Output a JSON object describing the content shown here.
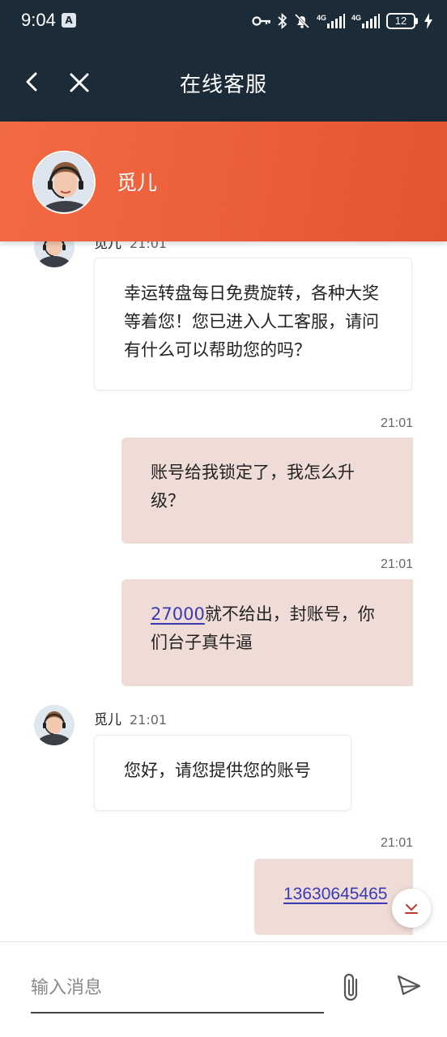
{
  "status_bar": {
    "time": "9:04",
    "app_icon_letter": "A",
    "battery_level": "12",
    "network_label_1": "4G",
    "network_label_2": "4G"
  },
  "app_bar": {
    "title": "在线客服",
    "back_icon": "chevron-left-icon",
    "close_icon": "close-icon"
  },
  "agent": {
    "name": "觅儿",
    "avatar_icon": "agent-avatar-headset"
  },
  "messages": [
    {
      "direction": "incoming",
      "sender": "觅儿",
      "time": "21:01",
      "text": "幸运转盘每日免费旋转，各种大奖等着您！您已进入人工客服，请问有什么可以帮助您的吗？"
    },
    {
      "direction": "outgoing",
      "time": "21:01",
      "text": "账号给我锁定了，我怎么升级？"
    },
    {
      "direction": "outgoing",
      "time": "21:01",
      "link_text": "27000",
      "text": "就不给出，封账号，你们台子真牛逼"
    },
    {
      "direction": "incoming",
      "sender": "觅儿",
      "time": "21:01",
      "text": "您好，请您提供您的账号"
    },
    {
      "direction": "outgoing",
      "time": "21:01",
      "link_text": "13630645465"
    }
  ],
  "input": {
    "placeholder": "输入消息",
    "value": ""
  },
  "colors": {
    "header_dark": "#1c2b38",
    "agent_header_orange": "#ef6440",
    "outgoing_bubble": "#f0dcd7",
    "link": "#3a3ab8"
  }
}
